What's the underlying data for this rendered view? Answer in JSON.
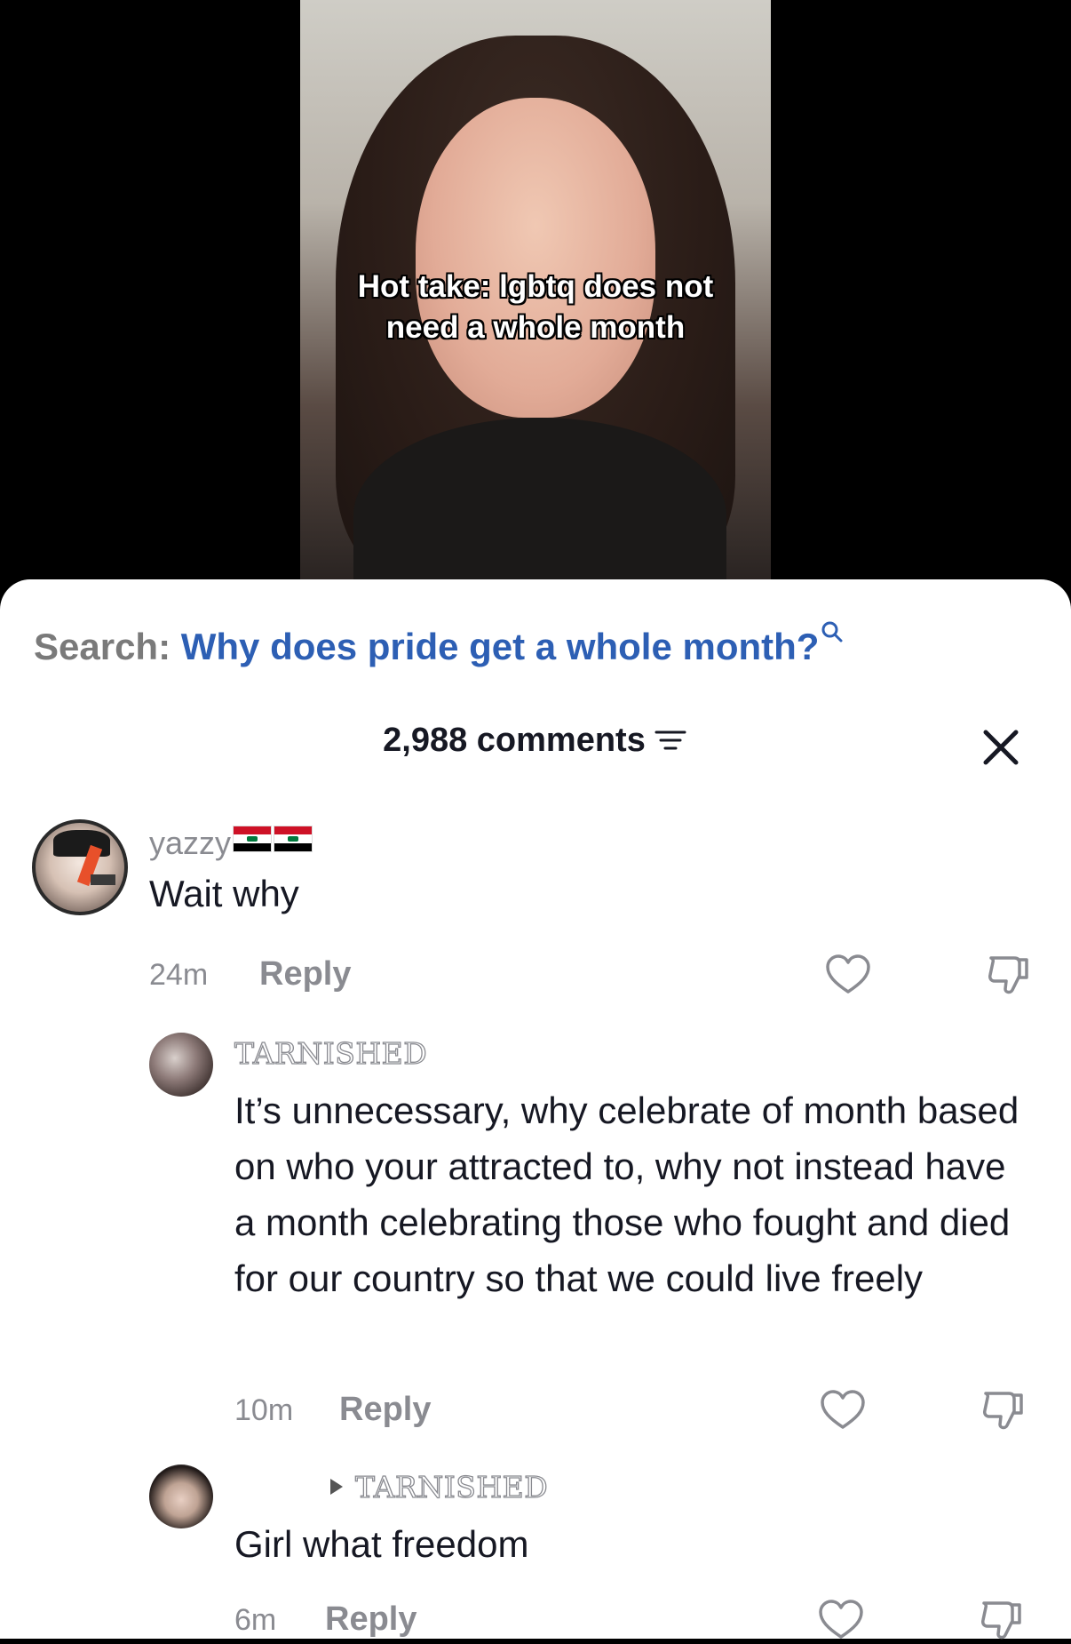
{
  "video": {
    "caption_line1": "Hot take: lgbtq does not",
    "caption_line2": "need a whole month"
  },
  "search": {
    "label": "Search:",
    "query": "Why does pride get a whole month?",
    "icon": "search-icon"
  },
  "header": {
    "comments_count": "2,988 comments",
    "filter_icon": "filter-icon",
    "close_icon": "close-icon"
  },
  "comments": [
    {
      "username": "yazzy",
      "flags": [
        "iraq-flag",
        "iraq-flag"
      ],
      "text": "Wait why",
      "time": "24m",
      "reply_label": "Reply"
    },
    {
      "username": "TARNISHED",
      "text": "It’s unnecessary, why celebrate of month based on who your attracted to, why not instead have a month celebrating those who fought and died for our country so that we could live freely",
      "time": "10m",
      "reply_label": "Reply"
    },
    {
      "reply_to": "TARNISHED",
      "text": "Girl what freedom",
      "time": "6m",
      "reply_label": "Reply"
    }
  ],
  "colors": {
    "search_query": "#2d5fb4",
    "muted_text": "#8a8b91",
    "primary_text": "#161823"
  }
}
